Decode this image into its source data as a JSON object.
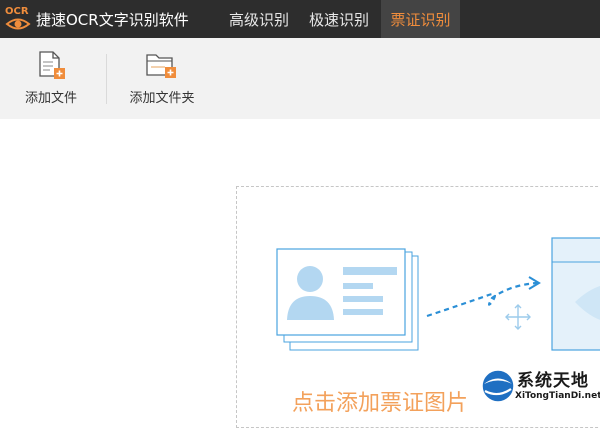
{
  "app": {
    "logo_text": "OCR",
    "title": "捷速OCR文字识别软件"
  },
  "tabs": [
    {
      "label": "高级识别",
      "active": false
    },
    {
      "label": "极速识别",
      "active": false
    },
    {
      "label": "票证识别",
      "active": true
    }
  ],
  "toolbar": {
    "add_file_label": "添加文件",
    "add_folder_label": "添加文件夹"
  },
  "drop_zone": {
    "prompt": "点击添加票证图片"
  },
  "watermark": {
    "title": "系统天地",
    "url": "XiTongTianDi.net"
  },
  "colors": {
    "titlebar_bg": "#2d2d2d",
    "active_tab_text": "#f08d3c",
    "accent_orange": "#f08d3c",
    "illustration_blue": "#4aa3df"
  }
}
